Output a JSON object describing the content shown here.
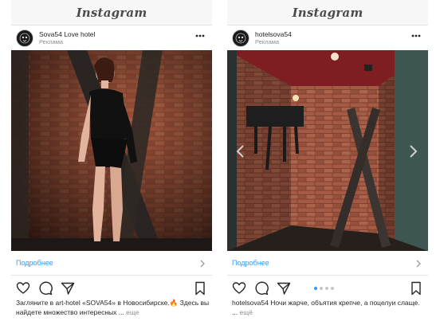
{
  "posts": [
    {
      "app_title": "Instagram",
      "username": "Sova54 Love hotel",
      "sponsored": "Реклама",
      "cta": "Подробнее",
      "caption_text": "Загляните в art-hotel «SOVA54» в Новосибирске.🔥 Здесь вы найдете множество интересных ...",
      "more_label": "еще",
      "carousel_dots": 0
    },
    {
      "app_title": "Instagram",
      "username": "hotelsova54",
      "sponsored": "Реклама",
      "cta": "Подробнее",
      "caption_user": "hotelsova54",
      "caption_text": "Ночи жарче, объятия крепче, а поцелуи слаще. ...",
      "more_label": "ещё",
      "carousel_dots": 4,
      "carousel_active_index": 0
    }
  ],
  "colors": {
    "link": "#3897f0",
    "muted": "#8e8e8e",
    "text": "#262626",
    "header_bg": "#f7f7f7"
  }
}
